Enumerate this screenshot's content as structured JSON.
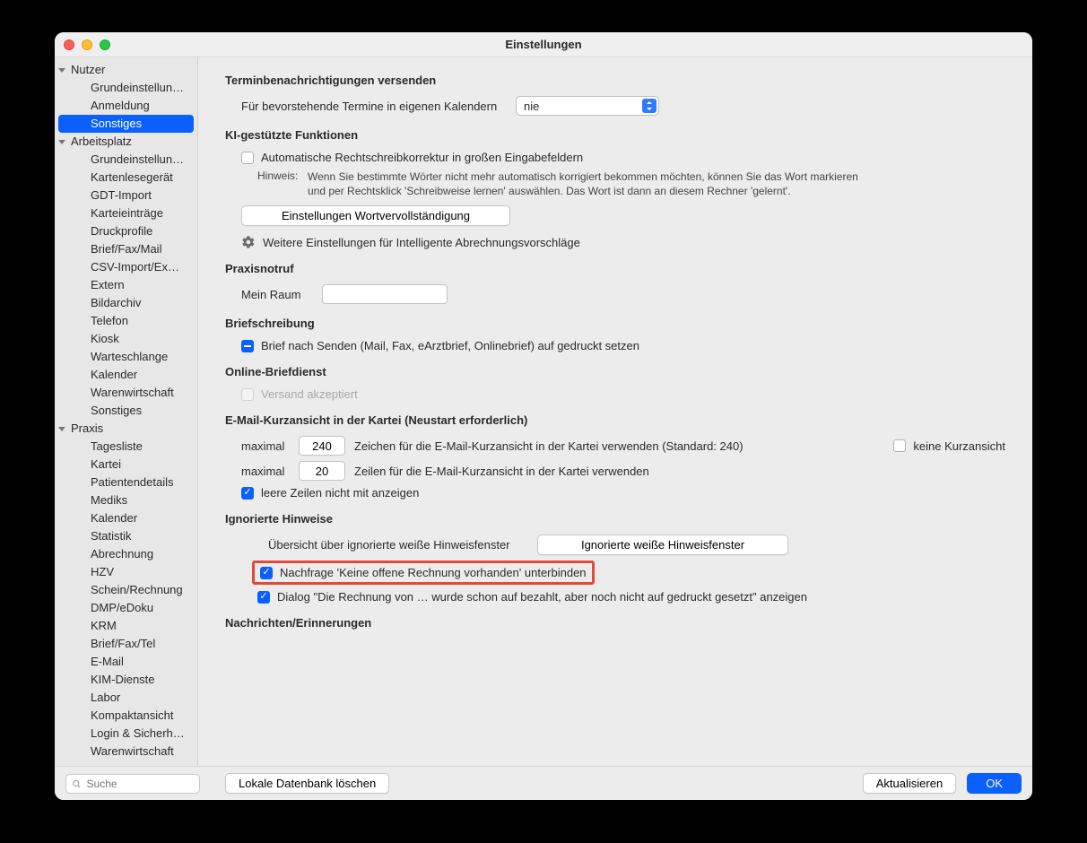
{
  "window": {
    "title": "Einstellungen"
  },
  "sidebar": {
    "groups": [
      {
        "label": "Nutzer",
        "items": [
          "Grundeinstellun…",
          "Anmeldung",
          "Sonstiges"
        ]
      },
      {
        "label": "Arbeitsplatz",
        "items": [
          "Grundeinstellun…",
          "Kartenlesegerät",
          "GDT-Import",
          "Karteieinträge",
          "Druckprofile",
          "Brief/Fax/Mail",
          "CSV-Import/Ex…",
          "Extern",
          "Bildarchiv",
          "Telefon",
          "Kiosk",
          "Warteschlange",
          "Kalender",
          "Warenwirtschaft",
          "Sonstiges"
        ]
      },
      {
        "label": "Praxis",
        "items": [
          "Tagesliste",
          "Kartei",
          "Patientendetails",
          "Mediks",
          "Kalender",
          "Statistik",
          "Abrechnung",
          "HZV",
          "Schein/Rechnung",
          "DMP/eDoku",
          "KRM",
          "Brief/Fax/Tel",
          "E-Mail",
          "KIM-Dienste",
          "Labor",
          "Kompaktansicht",
          "Login & Sicherh…",
          "Warenwirtschaft"
        ]
      }
    ],
    "selected": "Sonstiges"
  },
  "sections": {
    "s1": {
      "title": "Terminbenachrichtigungen versenden",
      "label": "Für bevorstehende Termine in eigenen Kalendern",
      "select": "nie"
    },
    "s2": {
      "title": "KI-gestützte Funktionen",
      "cb1": "Automatische Rechtschreibkorrektur in großen Eingabefeldern",
      "hintLabel": "Hinweis:",
      "hintText": "Wenn Sie bestimmte Wörter nicht mehr automatisch korrigiert bekommen möchten, können Sie das Wort markieren und per Rechtsklick 'Schreibweise lernen' auswählen. Das Wort ist dann an diesem Rechner 'gelernt'.",
      "btn": "Einstellungen Wortvervollständigung",
      "gearText": "Weitere Einstellungen für Intelligente Abrechnungsvorschläge"
    },
    "s3": {
      "title": "Praxisnotruf",
      "label": "Mein Raum",
      "value": ""
    },
    "s4": {
      "title": "Briefschreibung",
      "cb": "Brief nach Senden (Mail, Fax, eArztbrief, Onlinebrief) auf gedruckt setzen"
    },
    "s5": {
      "title": "Online-Briefdienst",
      "cb": "Versand akzeptiert"
    },
    "s6": {
      "title": "E-Mail-Kurzansicht in der Kartei (Neustart erforderlich)",
      "maxLabel": "maximal",
      "chars": "240",
      "charsText": "Zeichen für die E-Mail-Kurzansicht in der Kartei verwenden (Standard: 240)",
      "noShort": "keine Kurzansicht",
      "lines": "20",
      "linesText": "Zeilen für die E-Mail-Kurzansicht in der Kartei verwenden",
      "cbEmpty": "leere Zeilen nicht mit anzeigen"
    },
    "s7": {
      "title": "Ignorierte Hinweise",
      "overviewLabel": "Übersicht über ignorierte weiße Hinweisfenster",
      "btn": "Ignorierte weiße Hinweisfenster",
      "cb1": "Nachfrage 'Keine offene Rechnung vorhanden' unterbinden",
      "cb2": "Dialog \"Die Rechnung von … wurde schon auf bezahlt, aber noch nicht auf gedruckt gesetzt\" anzeigen"
    },
    "s8": {
      "title": "Nachrichten/Erinnerungen"
    }
  },
  "footer": {
    "searchPlaceholder": "Suche",
    "btnDelete": "Lokale Datenbank löschen",
    "btnRefresh": "Aktualisieren",
    "btnOk": "OK"
  }
}
